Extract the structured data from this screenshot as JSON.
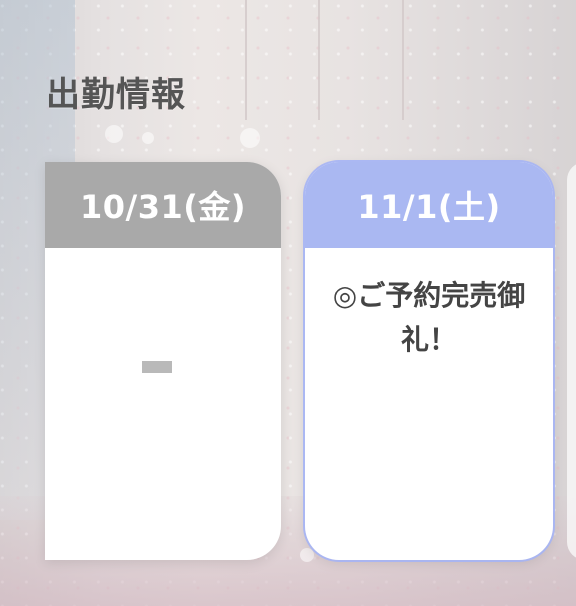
{
  "section": {
    "title": "出勤情報"
  },
  "schedule": [
    {
      "date": "10/31(金)",
      "content": "",
      "status": "off",
      "header_color": "#a9a9a9"
    },
    {
      "date": "11/1(土)",
      "content": "◎ご予約完売御礼！",
      "status": "scheduled",
      "header_color": "#aab8f2"
    }
  ]
}
